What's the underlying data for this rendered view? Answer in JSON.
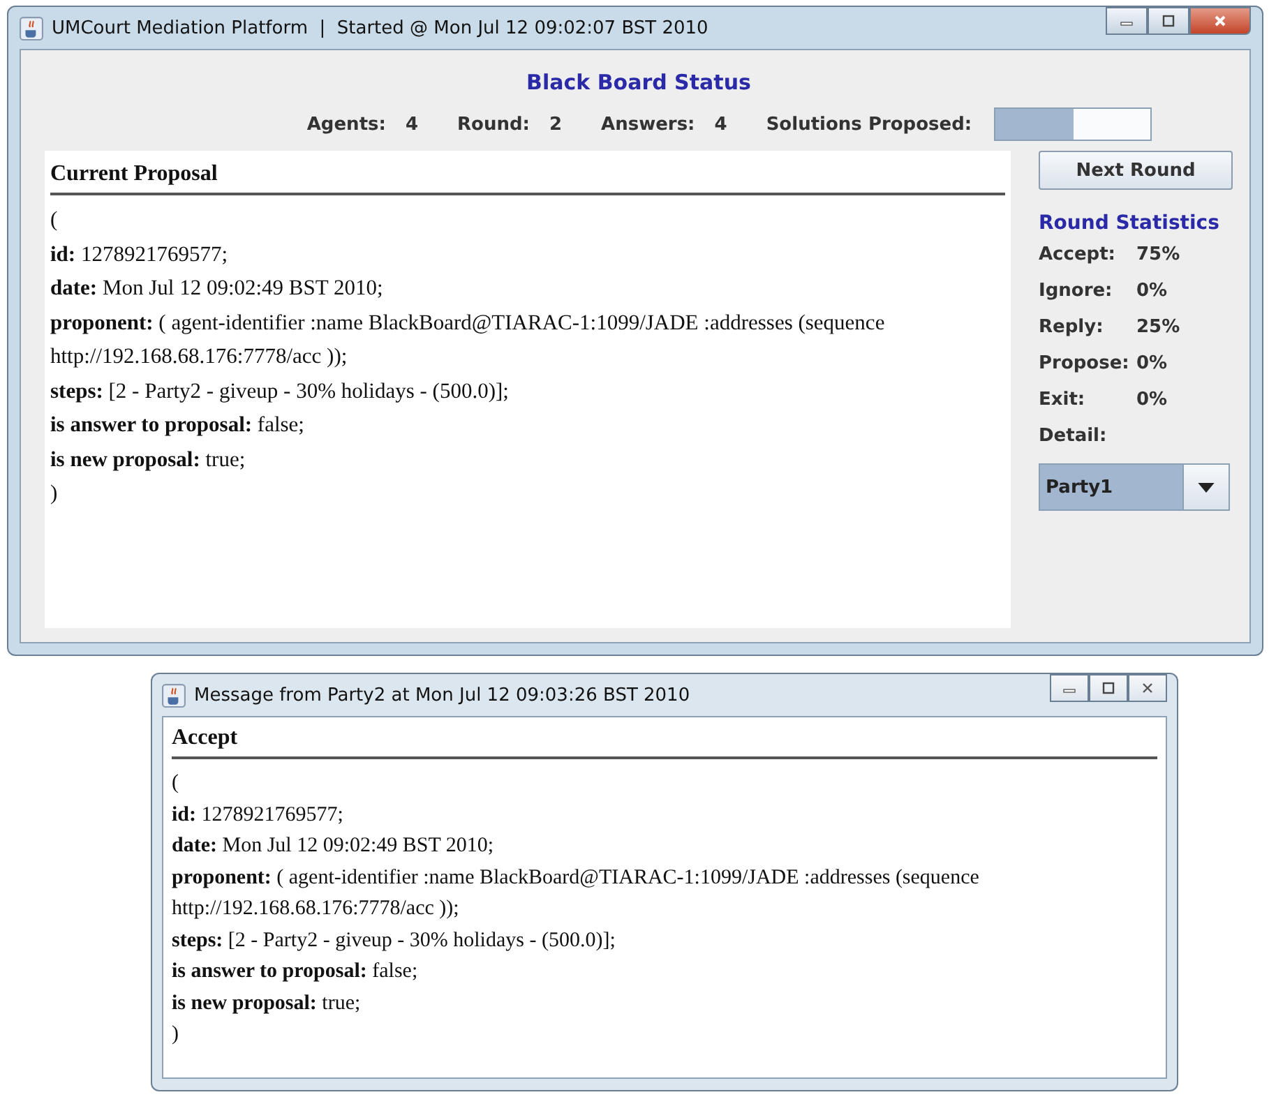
{
  "main_window": {
    "title": "UMCourt Mediation Platform  |  Started @ Mon Jul 12 09:02:07 BST 2010",
    "heading": "Black Board Status",
    "counters": [
      {
        "label": "Agents:",
        "value": "4"
      },
      {
        "label": "Round:",
        "value": "2"
      },
      {
        "label": "Answers:",
        "value": "4"
      }
    ],
    "solutions": {
      "label": "Solutions Proposed:",
      "level": 0.5
    },
    "proposal": {
      "title": "Current Proposal",
      "lines": [
        "(",
        "**id:** 1278921769577;",
        "**date:** Mon Jul 12 09:02:49 BST 2010;",
        "**proponent:** ( agent-identifier :name BlackBoard@TIARAC-1:1099/JADE :addresses (sequence http://192.168.68.176:7778/acc ));",
        "**steps:** [2 - Party2 - giveup - 30% holidays - (500.0)];",
        "**is answer to proposal:** false;",
        "**is new proposal:** true;",
        ")"
      ]
    },
    "next_button": "Next Round",
    "statistics": {
      "title": "Round Statistics",
      "rows": [
        {
          "label": "Accept:",
          "value": "75%"
        },
        {
          "label": "Ignore:",
          "value": "0%"
        },
        {
          "label": "Reply:",
          "value": "25%"
        },
        {
          "label": "Propose:",
          "value": "0%"
        },
        {
          "label": "Exit:",
          "value": "0%"
        }
      ],
      "detail_label": "Detail:",
      "detail_value": "Party1"
    }
  },
  "message_window": {
    "title": "Message from Party2 at Mon Jul 12 09:03:26 BST 2010",
    "message": {
      "title": "Accept",
      "lines": [
        "(",
        "**id:** 1278921769577;",
        "**date:** Mon Jul 12 09:02:49 BST 2010;",
        "**proponent:** ( agent-identifier :name BlackBoard@TIARAC-1:1099/JADE :addresses (sequence http://192.168.68.176:7778/acc ));",
        "**steps:** [2 - Party2 - giveup - 30% holidays - (500.0)];",
        "**is answer to proposal:** false;",
        "**is new proposal:** true;",
        ")"
      ]
    }
  }
}
